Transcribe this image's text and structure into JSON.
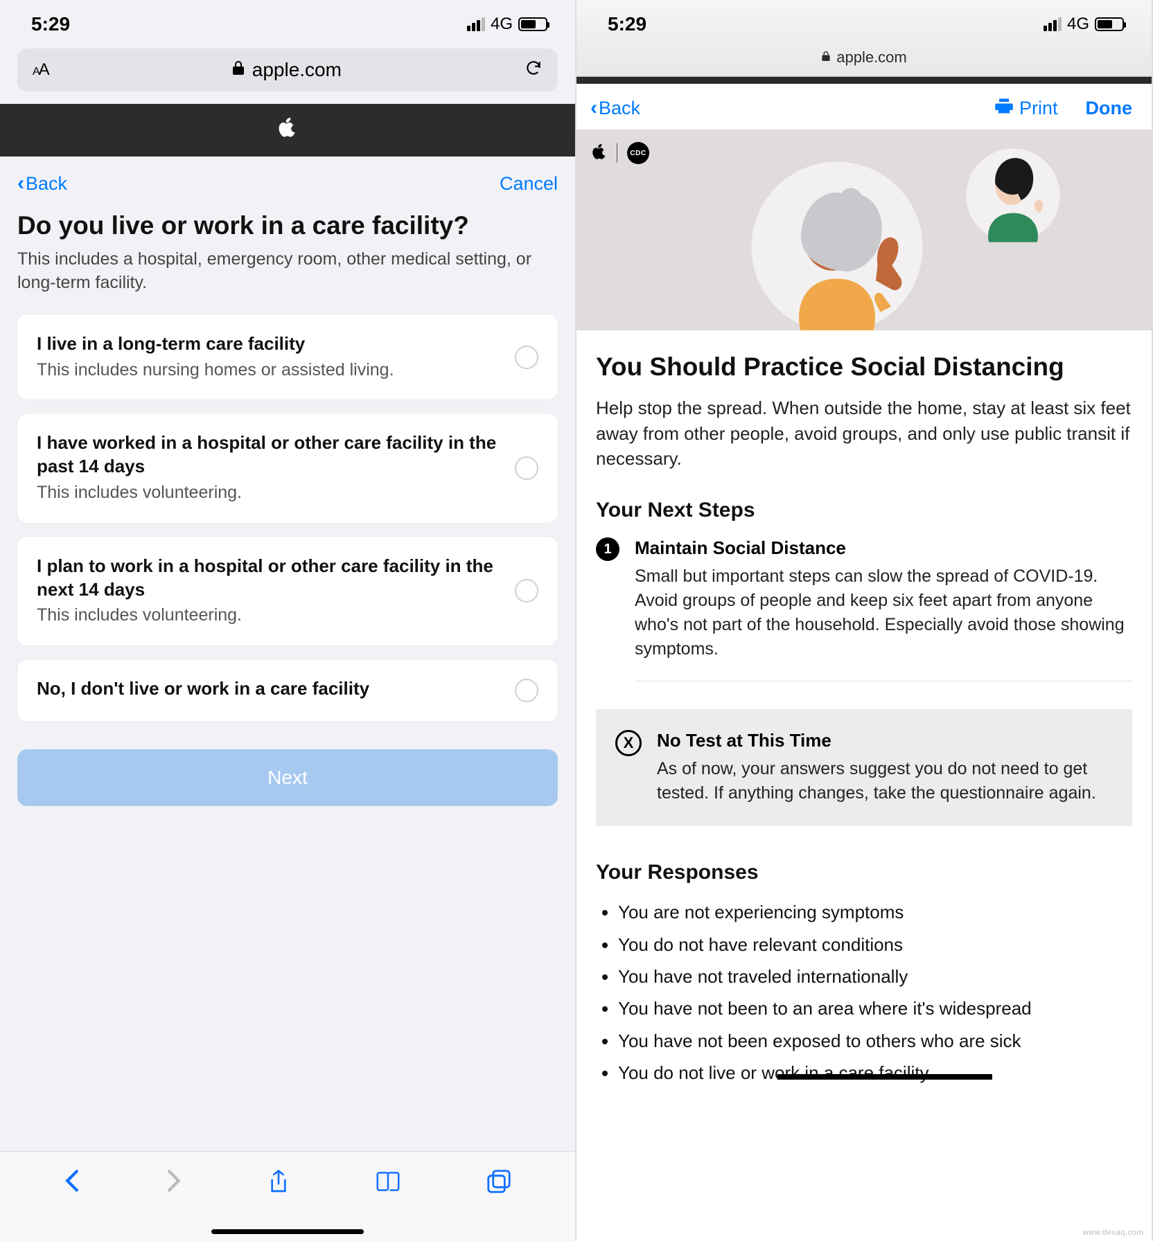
{
  "left": {
    "status": {
      "time": "5:29",
      "network": "4G"
    },
    "url": "apple.com",
    "nav": {
      "back": "Back",
      "cancel": "Cancel"
    },
    "heading": "Do you live or work in a care facility?",
    "sub": "This includes a hospital, emergency room, other medical setting, or long-term facility.",
    "options": [
      {
        "title": "I live in a long-term care facility",
        "desc": "This includes nursing homes or assisted living."
      },
      {
        "title": "I have worked in a hospital or other care facility in the past 14 days",
        "desc": "This includes volunteering."
      },
      {
        "title": "I plan to work in a hospital or other care facility in the next 14 days",
        "desc": "This includes volunteering."
      },
      {
        "title": "No, I don't live or work in a care facility",
        "desc": ""
      }
    ],
    "next": "Next"
  },
  "right": {
    "status": {
      "time": "5:29",
      "network": "4G"
    },
    "url": "apple.com",
    "nav": {
      "back": "Back",
      "print": "Print",
      "done": "Done"
    },
    "hero": {
      "cdc": "CDC"
    },
    "heading": "You Should Practice Social Distancing",
    "lead": "Help stop the spread. When outside the home, stay at least six feet away from other people, avoid groups, and only use public transit if necessary.",
    "steps_heading": "Your Next Steps",
    "steps": [
      {
        "num": "1",
        "title": "Maintain Social Distance",
        "desc": "Small but important steps can slow the spread of COVID-19. Avoid groups of people and keep six feet apart from anyone who's not part of the household. Especially avoid those showing symptoms."
      }
    ],
    "callout": {
      "title": "No Test at This Time",
      "desc": "As of now, your answers suggest you do not need to get tested. If anything changes, take the questionnaire again."
    },
    "responses_heading": "Your Responses",
    "responses": [
      "You are not experiencing symptoms",
      "You do not have relevant conditions",
      "You have not traveled internationally",
      "You have not been to an area where it's widespread",
      "You have not been exposed to others who are sick",
      "You do not live or work in a care facility"
    ]
  }
}
